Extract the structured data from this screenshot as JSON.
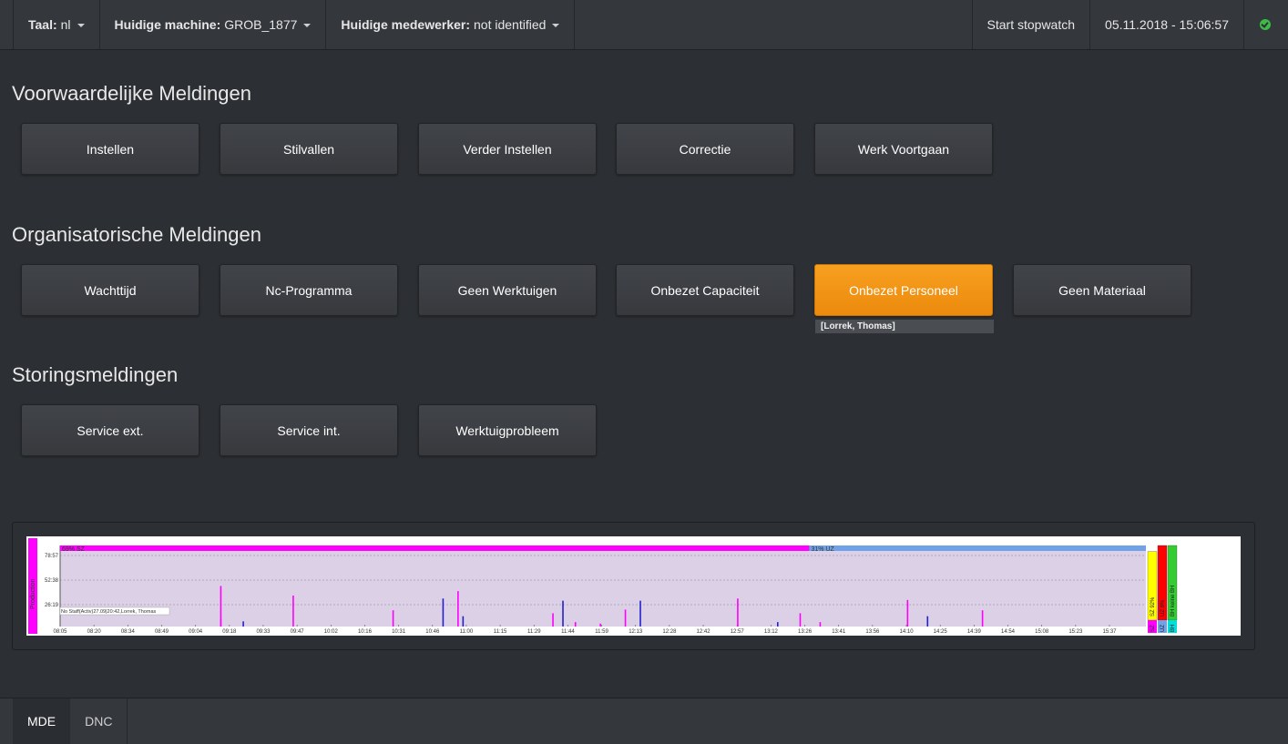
{
  "topbar": {
    "language_label": "Taal:",
    "language_value": "nl",
    "machine_label": "Huidige machine:",
    "machine_value": "GROB_1877",
    "employee_label": "Huidige medewerker:",
    "employee_value": "not identified",
    "stopwatch": "Start stopwatch",
    "datetime": "05.11.2018 - 15:06:57",
    "status_icon": "check-circle-icon",
    "status_color": "#3dbb46"
  },
  "sections": {
    "conditional": {
      "title": "Voorwaardelijke Meldingen",
      "buttons": [
        "Instellen",
        "Stilvallen",
        "Verder Instellen",
        "Correctie",
        "Werk Voortgaan"
      ]
    },
    "organizational": {
      "title": "Organisatorische Meldingen",
      "buttons": [
        "Wachttijd",
        "Nc-Programma",
        "Geen Werktuigen",
        "Onbezet Capaciteit",
        "Onbezet Personeel",
        "Geen Materiaal"
      ],
      "active_button": "Onbezet Personeel",
      "active_color": "#f39516",
      "active_staff": "[Lorrek, Thomas]"
    },
    "faults": {
      "title": "Storingsmeldingen",
      "buttons": [
        "Service ext.",
        "Service int.",
        "Werktuigprobleem"
      ]
    }
  },
  "chart_data": {
    "type": "bar",
    "side_label": "Production",
    "top_band": [
      {
        "label": "69% SZ",
        "fraction": 0.69,
        "color": "#ff00ff"
      },
      {
        "label": "31% UZ",
        "fraction": 0.31,
        "color": "#6fa2e8"
      }
    ],
    "y_ticks": [
      "78:57",
      "52:38",
      "26:19"
    ],
    "x_ticks": [
      "08:05",
      "08:20",
      "08:34",
      "08:49",
      "09:04",
      "09:18",
      "09:33",
      "09:47",
      "10:02",
      "10:16",
      "10:31",
      "10:46",
      "11:00",
      "11:15",
      "11:29",
      "11:44",
      "11:59",
      "12:13",
      "12:28",
      "12:42",
      "12:57",
      "13:12",
      "13:26",
      "13:41",
      "13:56",
      "14:10",
      "14:25",
      "14:39",
      "14:54",
      "15:08",
      "15:23",
      "15:37"
    ],
    "annotation": "No Staff(Activ)27.09|20:42,Lorrek, Thomas",
    "series": [
      {
        "color": "#ff00ff",
        "values": [
          [
            0.375,
            0.55
          ],
          [
            0.375,
            0.1
          ],
          [
            0.52,
            0.42
          ],
          [
            0.72,
            0.22
          ],
          [
            0.85,
            0.48
          ],
          [
            1.04,
            0.18
          ],
          [
            1.085,
            0.06
          ],
          [
            1.135,
            0.04
          ],
          [
            1.185,
            0.23
          ],
          [
            1.41,
            0.38
          ],
          [
            1.535,
            0.18
          ],
          [
            1.575,
            0.06
          ],
          [
            1.75,
            0.36
          ],
          [
            1.9,
            0.22
          ]
        ]
      },
      {
        "color": "#2222cc",
        "values": [
          [
            0.42,
            0.07
          ],
          [
            0.82,
            0.38
          ],
          [
            0.86,
            0.14
          ],
          [
            1.04,
            0.0
          ],
          [
            1.06,
            0.35
          ],
          [
            1.215,
            0.35
          ],
          [
            1.49,
            0.06
          ],
          [
            1.79,
            0.14
          ]
        ]
      }
    ],
    "side_bars": [
      {
        "label": "SZ 92%",
        "color": "#ffff00",
        "fraction": 0.92
      },
      {
        "label": "UZ 8%",
        "color": "#ff0000",
        "fraction": 1.0
      },
      {
        "label": "BH keine BH",
        "color": "#33cc33",
        "fraction": 1.0
      }
    ],
    "side_legend": [
      "SZ",
      "UZ",
      "BH"
    ],
    "side_legend_colors": [
      "#ff00ff",
      "#6fa2e8",
      "#00dddd"
    ]
  },
  "bottombar": {
    "tabs": [
      "MDE",
      "DNC"
    ],
    "active_tab": "MDE"
  }
}
